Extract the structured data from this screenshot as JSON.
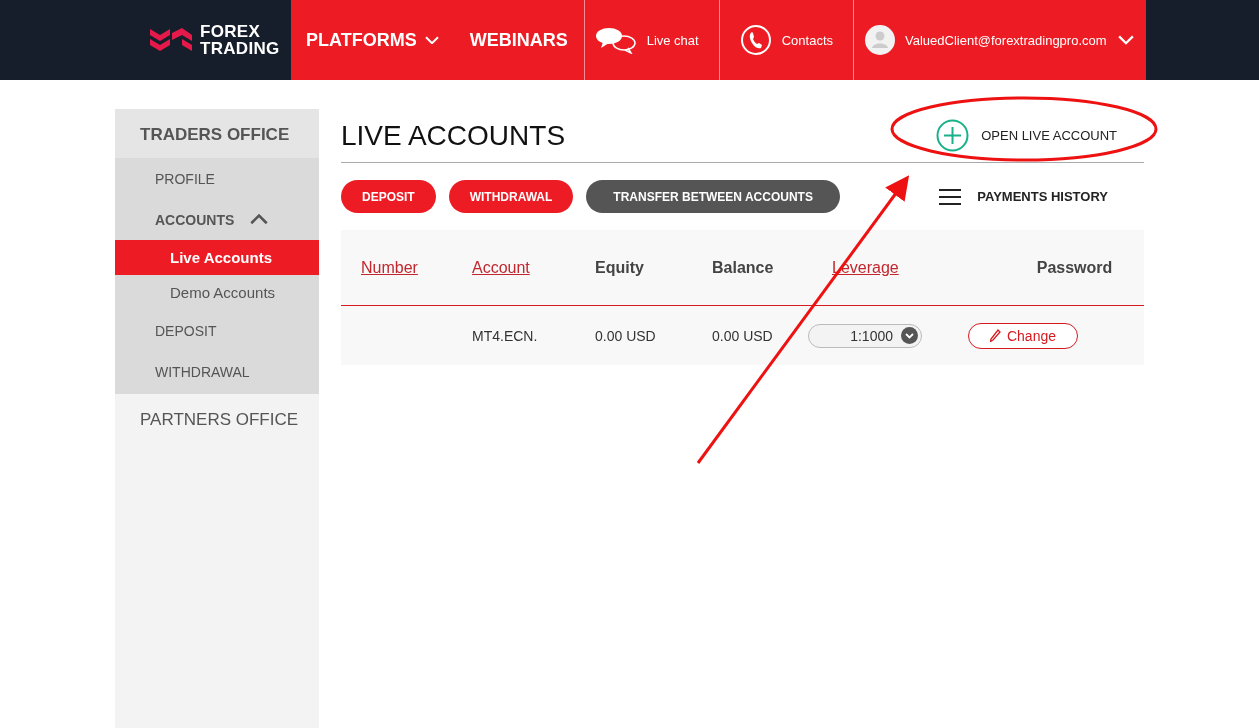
{
  "header": {
    "logo": [
      "FOREX",
      "TRADING"
    ],
    "menu": [
      {
        "label": "PLATFORMS",
        "has_dropdown": true
      },
      {
        "label": "WEBINARS",
        "has_dropdown": false
      }
    ],
    "actions": [
      {
        "kind": "chat",
        "label": "Live chat"
      },
      {
        "kind": "phone",
        "label": "Contacts"
      }
    ],
    "user": {
      "email": "ValuedClient@forextradingpro.com"
    }
  },
  "sidebar": {
    "sections": [
      {
        "title": "TRADERS OFFICE",
        "items": [
          {
            "label": "PROFILE"
          },
          {
            "label": "ACCOUNTS",
            "expanded": true,
            "children": [
              {
                "label": "Live Accounts",
                "selected": true
              },
              {
                "label": "Demo Accounts",
                "selected": false
              }
            ]
          },
          {
            "label": "DEPOSIT"
          },
          {
            "label": "WITHDRAWAL"
          }
        ]
      },
      {
        "title": "PARTNERS OFFICE"
      }
    ]
  },
  "page": {
    "title": "LIVE ACCOUNTS",
    "open_account": "OPEN LIVE ACCOUNT",
    "buttons": [
      {
        "label": "DEPOSIT",
        "kind": "primary"
      },
      {
        "label": "WITHDRAWAL",
        "kind": "primary"
      },
      {
        "label": "TRANSFER BETWEEN ACCOUNTS",
        "kind": "secondary"
      }
    ],
    "payments_history": "PAYMENTS HISTORY"
  },
  "table": {
    "columns": [
      {
        "label": "Number",
        "sortable": true
      },
      {
        "label": "Account",
        "sortable": true
      },
      {
        "label": "Equity",
        "sortable": false
      },
      {
        "label": "Balance",
        "sortable": false
      },
      {
        "label": "Leverage",
        "sortable": true
      },
      {
        "label": "Password",
        "sortable": false
      }
    ],
    "rows": [
      {
        "account": "MT4.ECN.",
        "equity": "0.00 USD",
        "balance": "0.00 USD",
        "leverage": "1:1000",
        "password_action": "Change"
      }
    ]
  },
  "annotation": {
    "kind": "ellipse-arrow"
  }
}
